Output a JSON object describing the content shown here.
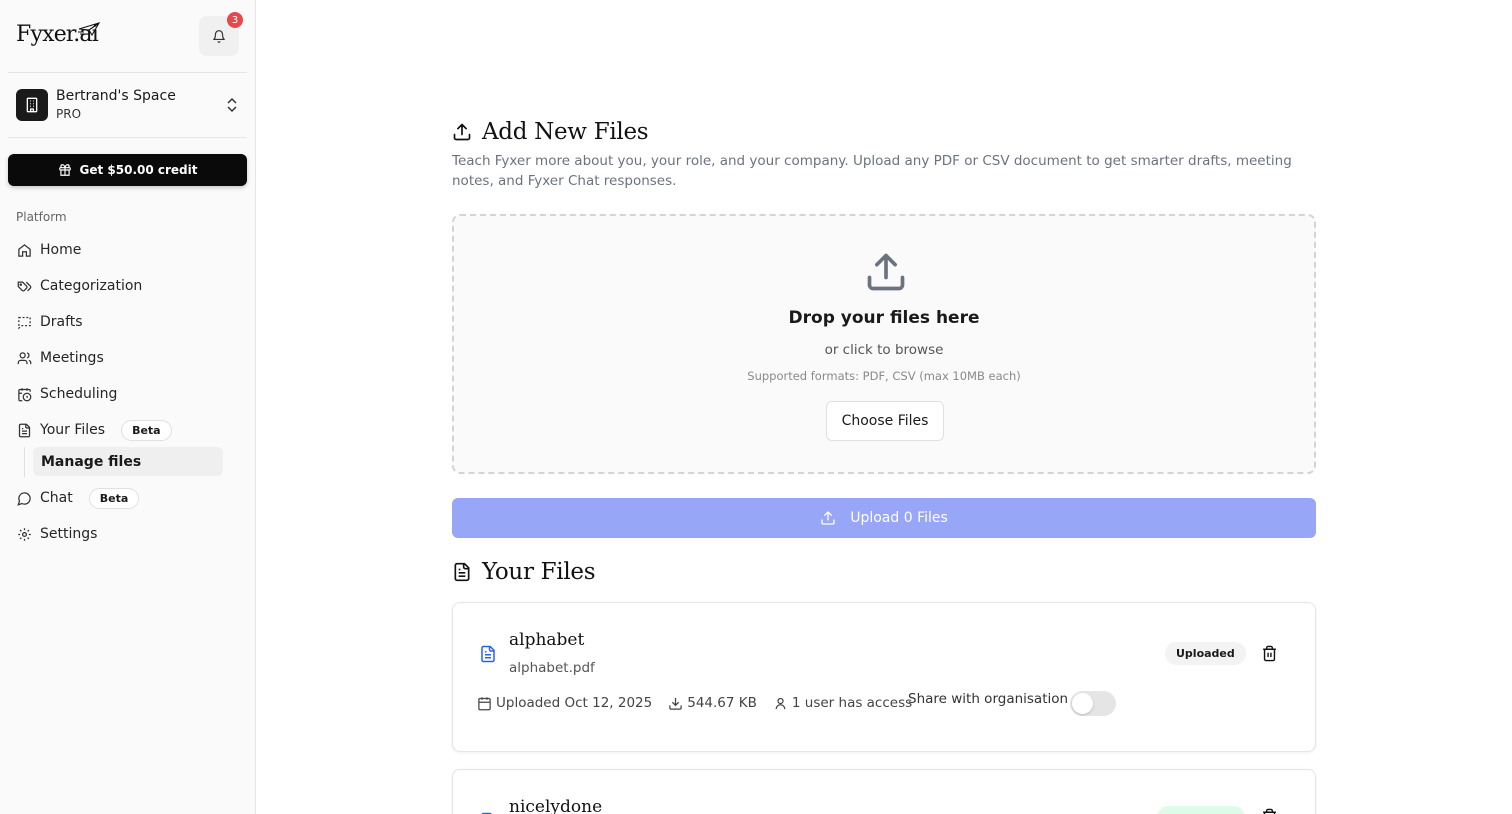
{
  "brand": {
    "logo_text": "Fyxer.ai",
    "notifications_count": "3"
  },
  "workspace": {
    "name": "Bertrand's Space",
    "plan": "PRO"
  },
  "credit_button": "Get $50.00 credit",
  "sidebar": {
    "section_label": "Platform",
    "items": [
      {
        "label": "Home",
        "icon": "home-icon"
      },
      {
        "label": "Categorization",
        "icon": "tags-icon"
      },
      {
        "label": "Drafts",
        "icon": "drafts-icon"
      },
      {
        "label": "Meetings",
        "icon": "users-icon"
      },
      {
        "label": "Scheduling",
        "icon": "calendar-clock-icon"
      },
      {
        "label": "Your Files",
        "icon": "file-text-icon",
        "badge": "Beta"
      },
      {
        "label": "Chat",
        "icon": "message-circle-icon",
        "badge": "Beta"
      },
      {
        "label": "Settings",
        "icon": "gear-icon"
      }
    ],
    "sub_item": "Manage files"
  },
  "main": {
    "add_title": "Add New Files",
    "add_description": "Teach Fyxer more about you, your role, and your company. Upload any PDF or CSV document to get smarter drafts, meeting notes, and Fyxer Chat responses.",
    "dropzone": {
      "title": "Drop your files here",
      "subtitle": "or click to browse",
      "formats": "Supported formats: PDF, CSV (max 10MB each)",
      "button": "Choose Files"
    },
    "upload_button": "Upload 0 Files",
    "files_title": "Your Files",
    "files": [
      {
        "name": "alphabet",
        "filename": "alphabet.pdf",
        "uploaded": "Uploaded Oct 12, 2025",
        "size": "544.67 KB",
        "access": "1 user has access",
        "share_label": "Share with organisation",
        "shared": false,
        "status": "Uploaded"
      },
      {
        "name": "nicelydone",
        "status": ""
      }
    ]
  },
  "colors": {
    "accent": "#97a6f7",
    "badge_red": "#e5484d",
    "file_icon_blue": "#2563eb"
  }
}
